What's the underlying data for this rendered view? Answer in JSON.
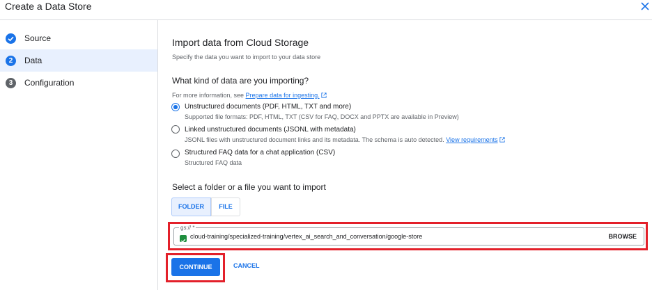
{
  "header": {
    "title": "Create a Data Store"
  },
  "steps": [
    {
      "number": "",
      "label": "Source",
      "status": "done"
    },
    {
      "number": "2",
      "label": "Data",
      "status": "current"
    },
    {
      "number": "3",
      "label": "Configuration",
      "status": "pending"
    }
  ],
  "main": {
    "heading": "Import data from Cloud Storage",
    "subheading": "Specify the data you want to import to your data store",
    "kind_heading": "What kind of data are you importing?",
    "info_prefix": "For more information, see ",
    "info_link": "Prepare data for ingesting.",
    "options": [
      {
        "label": "Unstructured documents (PDF, HTML, TXT and more)",
        "desc": "Supported file formats: PDF, HTML, TXT (CSV for FAQ, DOCX and PPTX are available in Preview)",
        "checked": true
      },
      {
        "label": "Linked unstructured documents (JSONL with metadata)",
        "desc": "JSONL files with unstructured document links and its metadata. The schema is auto detected.",
        "desc_link": "View requirements",
        "checked": false
      },
      {
        "label": "Structured FAQ data for a chat application (CSV)",
        "desc": "Structured FAQ data",
        "checked": false
      }
    ],
    "select_heading": "Select a folder or a file you want to import",
    "segments": {
      "folder": "FOLDER",
      "file": "FILE",
      "selected": "folder"
    },
    "gcs_field": {
      "label": "gs:// *",
      "value": "cloud-training/specialized-training/vertex_ai_search_and_conversation/google-store",
      "browse": "BROWSE"
    },
    "continue": "CONTINUE",
    "cancel": "CANCEL"
  },
  "colors": {
    "accent": "#1a73e8",
    "highlight": "#e3202a",
    "success": "#1e8e3e"
  }
}
